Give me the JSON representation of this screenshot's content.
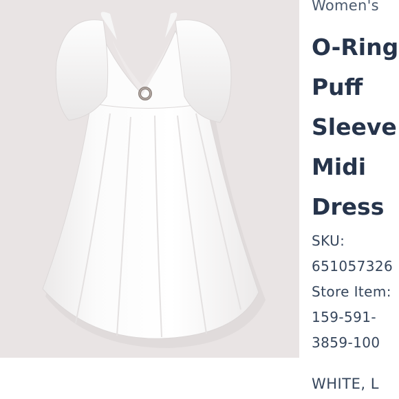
{
  "product": {
    "image_alt": "white dress product photo",
    "category": "Women's",
    "title_lines": [
      "O-Ring",
      "Puff",
      "Sleeve",
      "Midi",
      "Dress"
    ],
    "sku_label": "SKU:",
    "sku_value": "651057326",
    "store_item_label": "Store Item:",
    "store_item_lines": [
      "159-591-",
      "3859-100"
    ],
    "color": "WHITE, L"
  },
  "colors": {
    "text_primary": "#26344b",
    "text_secondary": "#36465c",
    "photo_background": "#e9e4e4",
    "dress": "#fafafa"
  },
  "icons": {
    "ring": "o-ring-icon"
  }
}
